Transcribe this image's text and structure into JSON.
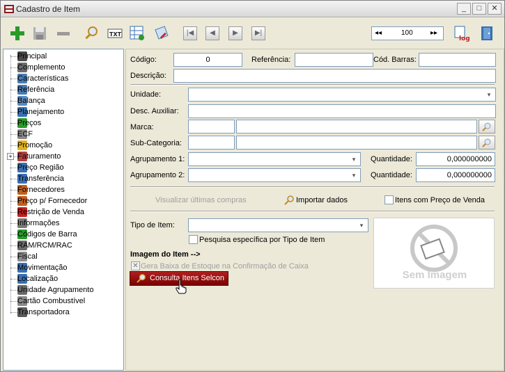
{
  "window": {
    "title": "Cadastro de Item",
    "minimize": "_",
    "maximize": "□",
    "close": "✕"
  },
  "toolbar": {
    "record_first": "◂◂",
    "record_value": "100",
    "record_last": "▸▸"
  },
  "sidebar": {
    "items": [
      {
        "label": "Principal"
      },
      {
        "label": "Complemento"
      },
      {
        "label": "Características"
      },
      {
        "label": "Referência"
      },
      {
        "label": "Balança"
      },
      {
        "label": "Planejamento"
      },
      {
        "label": "Preços"
      },
      {
        "label": "ECF"
      },
      {
        "label": "Promoção"
      },
      {
        "label": "Faturamento"
      },
      {
        "label": "Preço Região"
      },
      {
        "label": "Transferência"
      },
      {
        "label": "Fornecedores"
      },
      {
        "label": "Preço p/ Fornecedor"
      },
      {
        "label": "Restrição de Venda"
      },
      {
        "label": "Informações"
      },
      {
        "label": "Códigos de Barra"
      },
      {
        "label": "RAM/RCM/RAC"
      },
      {
        "label": "Fiscal"
      },
      {
        "label": "Movimentação"
      },
      {
        "label": "Localização"
      },
      {
        "label": "Unidade Agrupamento"
      },
      {
        "label": "Cartão Combustível"
      },
      {
        "label": "Transportadora"
      }
    ]
  },
  "form": {
    "codigo_label": "Código:",
    "codigo_value": "0",
    "referencia_label": "Referência:",
    "cod_barras_label": "Cód. Barras:",
    "descricao_label": "Descrição:",
    "unidade_label": "Unidade:",
    "desc_auxiliar_label": "Desc. Auxiliar:",
    "marca_label": "Marca:",
    "subcategoria_label": "Sub-Categoria:",
    "agrup1_label": "Agrupamento 1:",
    "agrup2_label": "Agrupamento 2:",
    "quantidade1_label": "Quantidade:",
    "quantidade1_value": "0,000000000",
    "quantidade2_label": "Quantidade:",
    "quantidade2_value": "0,000000000",
    "visualizar_compras": "Visualizar últimas compras",
    "importar_dados": "Importar dados",
    "itens_preco_venda": "Itens com Preço de Venda",
    "tipo_item_label": "Tipo de Item:",
    "pesquisa_especifica": "Pesquisa específica por Tipo de Item",
    "imagem_item": "Imagem do Item -->",
    "gera_baixa": "Gera Baixa de Estoque na Confirmação de Caixa",
    "consulta_selcon": "Consulta Itens Selcon",
    "sem_imagem": "Sem Imagem"
  }
}
